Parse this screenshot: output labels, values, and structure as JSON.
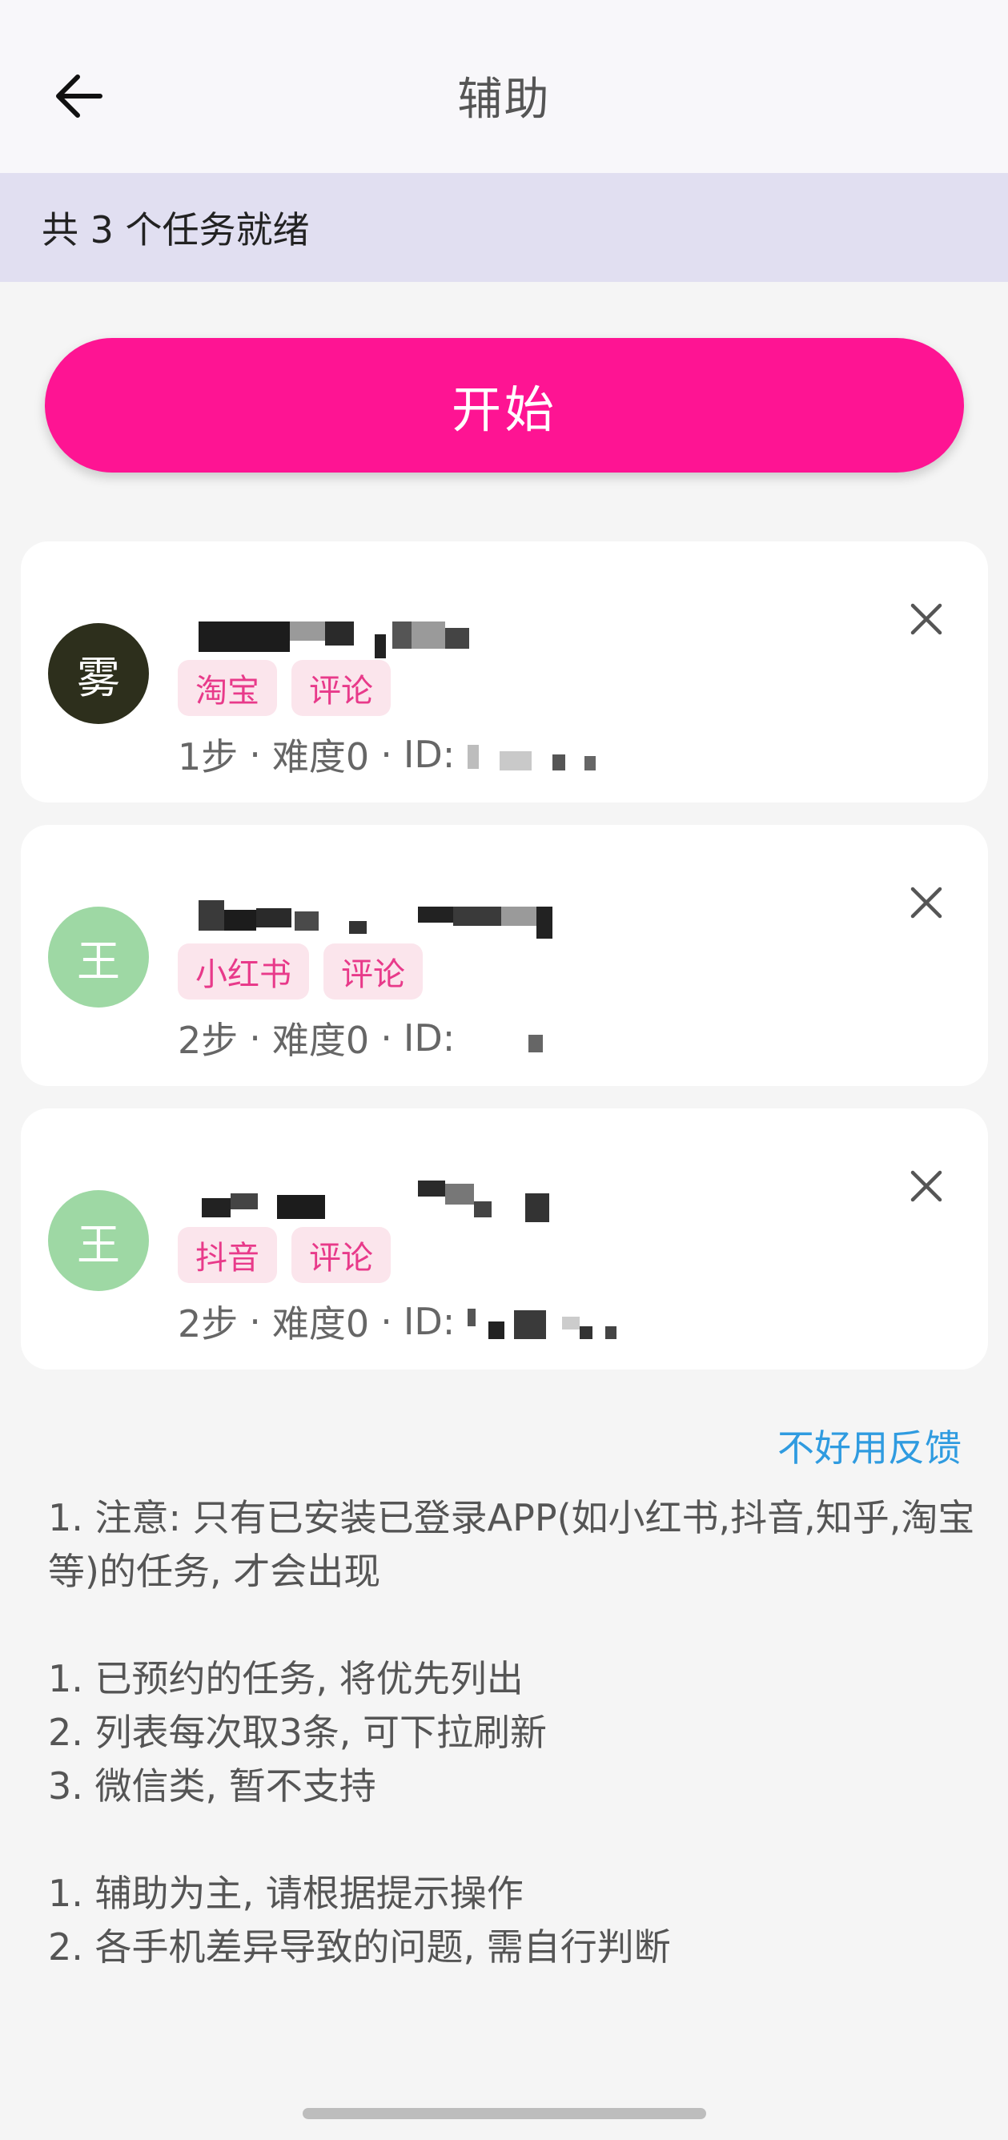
{
  "header": {
    "title": "辅助",
    "back_icon": "arrow-left-icon"
  },
  "status_banner": {
    "text": "共 3 个任务就绪"
  },
  "start_button": {
    "label": "开始",
    "color": "#fe1493"
  },
  "tasks": [
    {
      "avatar_text": "雾",
      "avatar_color": "#2d2f1c",
      "tags": [
        "淘宝",
        "评论"
      ],
      "steps": "1步",
      "difficulty": "难度0",
      "id_label": "ID:",
      "close_icon": "close-icon"
    },
    {
      "avatar_text": "王",
      "avatar_color": "#9ed8a4",
      "tags": [
        "小红书",
        "评论"
      ],
      "steps": "2步",
      "difficulty": "难度0",
      "id_label": "ID:",
      "close_icon": "close-icon"
    },
    {
      "avatar_text": "王",
      "avatar_color": "#9ed8a4",
      "tags": [
        "抖音",
        "评论"
      ],
      "steps": "2步",
      "difficulty": "难度0",
      "id_label": "ID:",
      "close_icon": "close-icon"
    }
  ],
  "feedback_link": "不好用反馈",
  "notes": {
    "group1": [
      "1. 注意: 只有已安装已登录APP(如小红书,抖音,知乎,淘宝等)的任务, 才会出现"
    ],
    "group2": [
      "1. 已预约的任务, 将优先列出",
      "2. 列表每次取3条, 可下拉刷新",
      "3. 微信类, 暂不支持"
    ],
    "group3": [
      "1. 辅助为主, 请根据提示操作",
      "2. 各手机差异导致的问题, 需自行判断"
    ]
  },
  "separator": "·"
}
